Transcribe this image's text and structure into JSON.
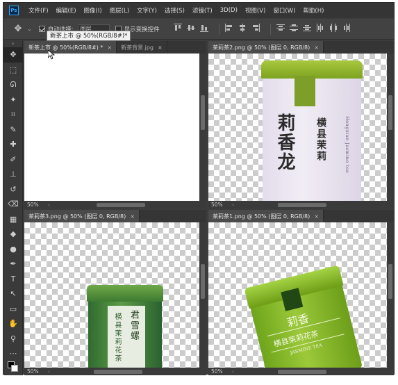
{
  "menu": {
    "logo": "Ps",
    "items": [
      "文件(F)",
      "编辑(E)",
      "图像(I)",
      "图层(L)",
      "文字(Y)",
      "选择(S)",
      "滤镜(T)",
      "3D(D)",
      "视图(V)",
      "窗口(W)",
      "帮助(H)"
    ]
  },
  "options": {
    "auto_select_label": "自动选择:",
    "auto_select_value": "图层",
    "show_transform_label": "显示变换控件"
  },
  "tooltip": "新茶上市 @ 50%(RGB/8#)*",
  "toolbar": {
    "grip": "»",
    "tools": [
      "move-tool-icon",
      "marquee-tool-icon",
      "lasso-tool-icon",
      "magic-wand-icon",
      "crop-tool-icon",
      "eyedropper-icon",
      "healing-brush-icon",
      "brush-tool-icon",
      "clone-stamp-icon",
      "history-brush-icon",
      "eraser-icon",
      "gradient-tool-icon",
      "blur-tool-icon",
      "dodge-tool-icon",
      "pen-tool-icon",
      "type-tool-icon",
      "path-select-icon",
      "rectangle-tool-icon",
      "hand-tool-icon",
      "zoom-tool-icon",
      "more-tools-icon"
    ],
    "glyphs": [
      "✥",
      "⬚",
      "ᘏ",
      "✦",
      "⌗",
      "✎",
      "✚",
      "✐",
      "⊥",
      "↺",
      "⌫",
      "▦",
      "◆",
      "●",
      "✒",
      "T",
      "↖",
      "▭",
      "✋",
      "⚲",
      "⋯"
    ]
  },
  "docs": {
    "top_left": {
      "tabs": [
        {
          "label": "新茶上市 @ 50%(RGB/8#) *",
          "close": "×"
        },
        {
          "label": "新茶背景.jpg",
          "close": "×"
        }
      ],
      "zoom": "50%"
    },
    "top_right": {
      "tabs": [
        {
          "label": "茉莉茶2.png @ 50% (图层 0, RGB/8)",
          "close": "×"
        }
      ],
      "zoom": "50%",
      "can_text": {
        "main": "莉香龙",
        "side": "横县茉莉",
        "pinyin": "Hengxian Jasmine tea"
      }
    },
    "bottom_left": {
      "tabs": [
        {
          "label": "茉莉茶3.png @ 50% (图层 0, RGB/8)",
          "close": "×"
        }
      ],
      "zoom": "50%",
      "can_text": {
        "main": "君雪螺",
        "side": "横县茉莉花茶"
      }
    },
    "bottom_right": {
      "tabs": [
        {
          "label": "茉莉茶1.png @ 50% (图层 0, RGB/8)",
          "close": "×"
        }
      ],
      "zoom": "50%",
      "can_text": {
        "main": "莉香",
        "side": "横县茉莉花茶",
        "pinyin": "JASMINE TEA"
      }
    }
  },
  "colors": {
    "app_bg": "#3c3c3c",
    "ps_blue": "#31a8ff",
    "can_green": "#7ea320"
  }
}
